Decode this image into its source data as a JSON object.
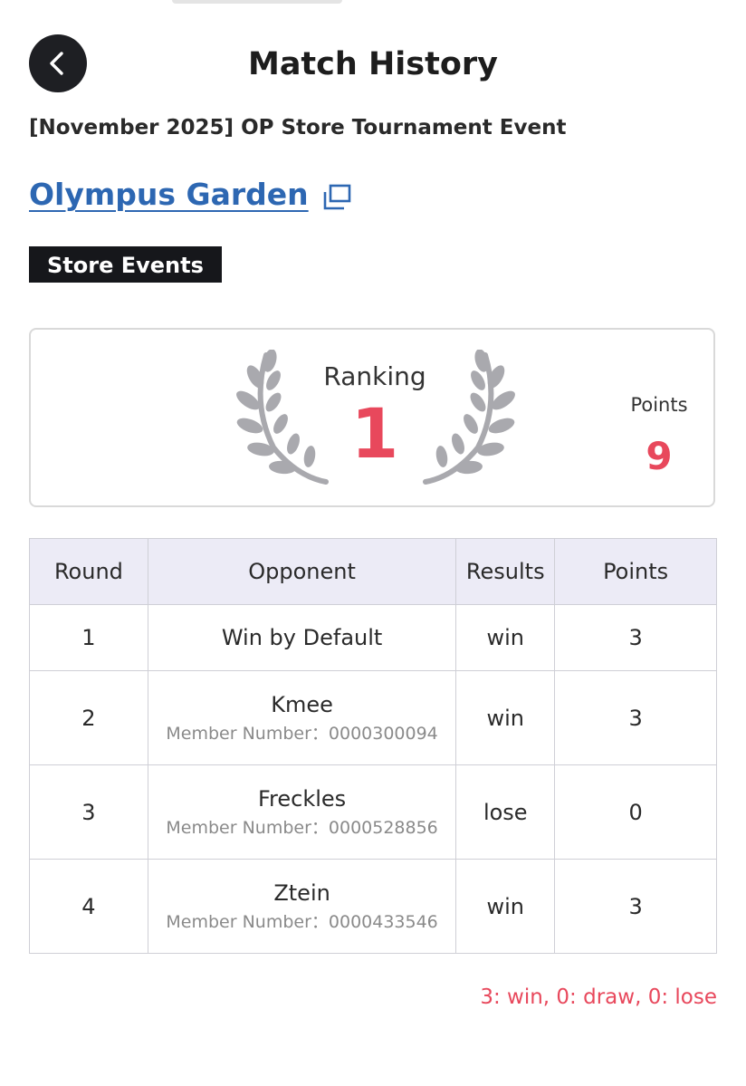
{
  "header": {
    "title": "Match History"
  },
  "event": {
    "name": "[November 2025] OP Store Tournament Event",
    "store_name": "Olympus Garden",
    "category": "Store Events"
  },
  "summary": {
    "ranking_label": "Ranking",
    "ranking_value": "1",
    "points_label": "Points",
    "points_value": "9"
  },
  "table": {
    "headers": [
      "Round",
      "Opponent",
      "Results",
      "Points"
    ],
    "rows": [
      {
        "round": "1",
        "opponent": "Win by Default",
        "member": "",
        "result": "win",
        "points": "3"
      },
      {
        "round": "2",
        "opponent": "Kmee",
        "member": "Member Number：0000300094",
        "result": "win",
        "points": "3"
      },
      {
        "round": "3",
        "opponent": "Freckles",
        "member": "Member Number：0000528856",
        "result": "lose",
        "points": "0"
      },
      {
        "round": "4",
        "opponent": "Ztein",
        "member": "Member Number：0000433546",
        "result": "win",
        "points": "3"
      }
    ]
  },
  "legend": "3: win, 0: draw, 0: lose",
  "icons": {
    "back": "chevron-left-icon",
    "external_link": "external-link-icon",
    "laurel": "laurel-wreath-icon"
  },
  "colors": {
    "accent": "#e8485c",
    "link": "#2d67b2",
    "header_bg": "#ecebf6",
    "tag_bg": "#16171b",
    "laurel": "#a9a9ae"
  }
}
